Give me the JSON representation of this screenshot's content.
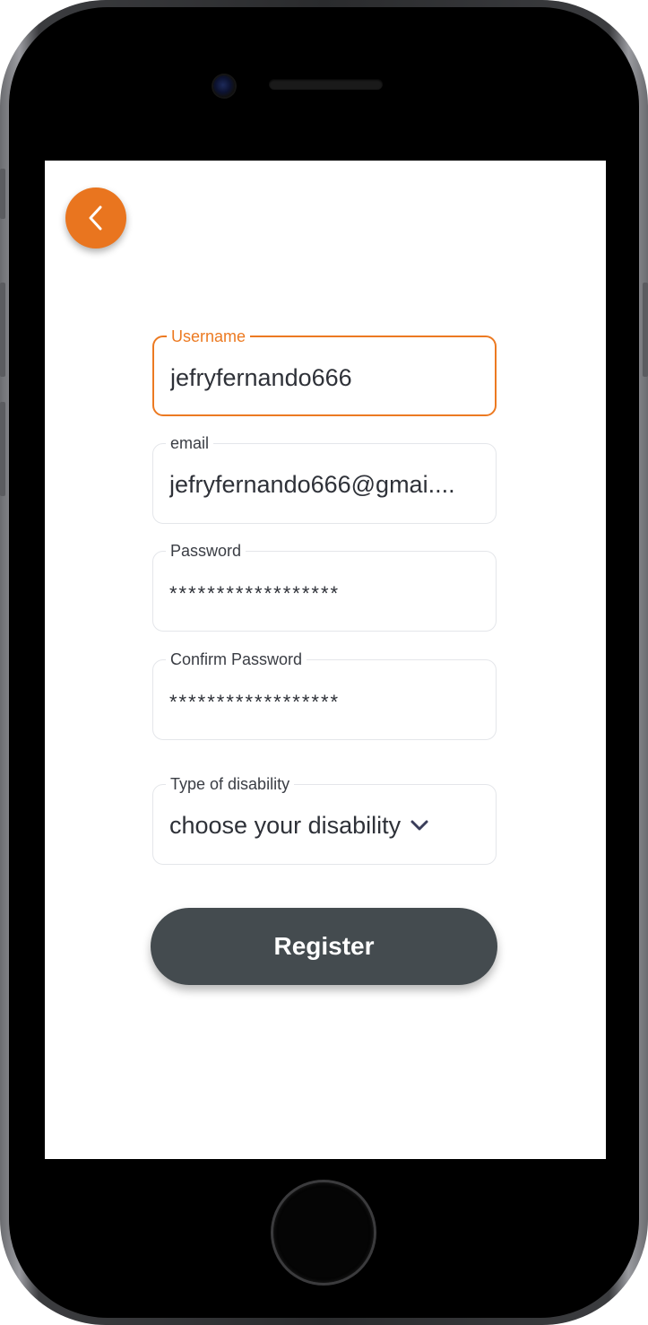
{
  "form": {
    "username": {
      "label": "Username",
      "value": "jefryfernando666"
    },
    "email": {
      "label": "email",
      "value": "jefryfernando666@gmai...."
    },
    "password": {
      "label": "Password",
      "value": "******************"
    },
    "confirm_password": {
      "label": "Confirm Password",
      "value": "******************"
    },
    "disability": {
      "label": "Type of disability",
      "selected": "choose your disability"
    }
  },
  "actions": {
    "register_label": "Register"
  },
  "icons": {
    "back": "chevron-left-icon",
    "dropdown": "chevron-down-icon"
  },
  "colors": {
    "accent": "#e9751f",
    "button": "#444b4f",
    "text": "#2e3138",
    "border": "#e4e6ea"
  }
}
